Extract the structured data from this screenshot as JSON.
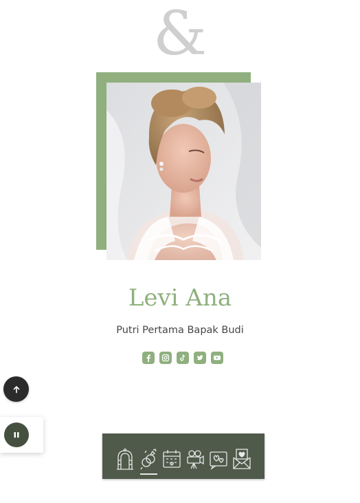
{
  "decor": {
    "ampersand": "&"
  },
  "profile": {
    "name": "Levi Ana",
    "subtitle": "Putri Pertama Bapak Budi",
    "photo_alt": "bride-portrait"
  },
  "socials": [
    {
      "icon": "facebook-icon"
    },
    {
      "icon": "instagram-icon"
    },
    {
      "icon": "tiktok-icon"
    },
    {
      "icon": "twitter-icon"
    },
    {
      "icon": "youtube-icon"
    }
  ],
  "floating": {
    "scroll_top_icon": "arrow-up-icon",
    "music_icon": "pause-icon"
  },
  "nav": {
    "items": [
      {
        "icon": "wedding-arch-icon"
      },
      {
        "icon": "couple-rings-icon",
        "active": true
      },
      {
        "icon": "calendar-icon"
      },
      {
        "icon": "video-camera-icon"
      },
      {
        "icon": "gallery-hearts-icon"
      },
      {
        "icon": "envelope-heart-icon"
      }
    ]
  },
  "colors": {
    "accent": "#8fb07e",
    "nav_bg": "#4f5a4a",
    "ampersand": "#cfcfcf",
    "text": "#454545",
    "scroll_btn": "#2b2b2b",
    "music_btn": "#45503f"
  }
}
